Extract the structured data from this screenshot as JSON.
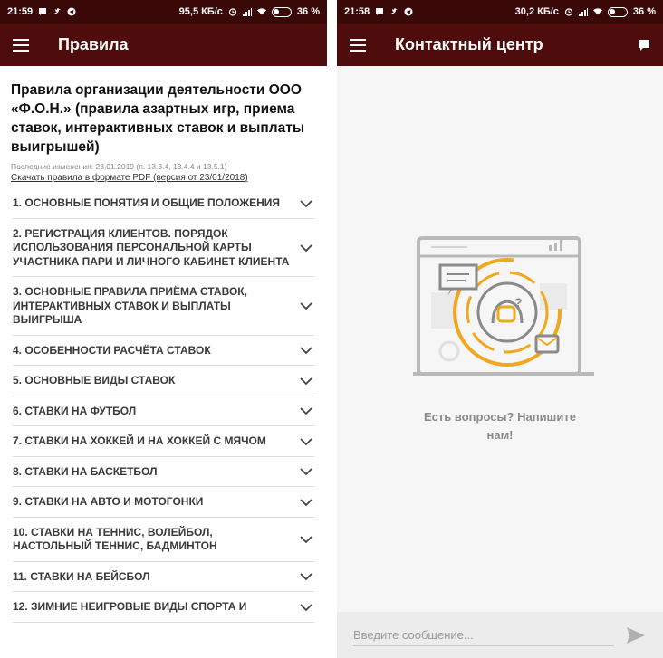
{
  "left": {
    "status": {
      "time": "21:59",
      "speed": "95,5 КБ/с",
      "battery": "36 %"
    },
    "appbar": {
      "title": "Правила"
    },
    "header": {
      "title": "Правила организации деятельности ООО «Ф.О.Н.» (правила азартных игр, приема ставок, интерактивных ставок и выплаты выигрышей)",
      "updated": "Последние изменения: 23.01.2019 (п. 13.3.4, 13.4.4 и 13.5.1)",
      "pdf_link": "Скачать правила в формате PDF (версия от 23/01/2018)"
    },
    "rules": [
      "1. ОСНОВНЫЕ ПОНЯТИЯ И ОБЩИЕ ПОЛОЖЕНИЯ",
      "2. РЕГИСТРАЦИЯ КЛИЕНТОВ. ПОРЯДОК ИСПОЛЬЗОВАНИЯ ПЕРСОНАЛЬНОЙ КАРТЫ УЧАСТНИКА ПАРИ И ЛИЧНОГО КАБИНЕТ КЛИЕНТА",
      "3. ОСНОВНЫЕ ПРАВИЛА ПРИЁМА СТАВОК, ИНТЕРАКТИВНЫХ СТАВОК И ВЫПЛАТЫ ВЫИГРЫША",
      "4. ОСОБЕННОСТИ РАСЧЁТА СТАВОК",
      "5. ОСНОВНЫЕ ВИДЫ СТАВОК",
      "6. СТАВКИ НА ФУТБОЛ",
      "7. СТАВКИ НА ХОККЕЙ И НА ХОККЕЙ С МЯЧОМ",
      "8. СТАВКИ НА БАСКЕТБОЛ",
      "9. СТАВКИ НА АВТО И МОТОГОНКИ",
      "10. СТАВКИ НА ТЕННИС, ВОЛЕЙБОЛ, НАСТОЛЬНЫЙ ТЕННИС, БАДМИНТОН",
      "11. СТАВКИ НА БЕЙСБОЛ",
      "12. ЗИМНИЕ НЕИГРОВЫЕ ВИДЫ СПОРТА И"
    ]
  },
  "right": {
    "status": {
      "time": "21:58",
      "speed": "30,2 КБ/с",
      "battery": "36 %"
    },
    "appbar": {
      "title": "Контактный центр"
    },
    "empty_state": {
      "text": "Есть вопросы? Напишите нам!"
    },
    "composer": {
      "placeholder": "Введите сообщение..."
    }
  },
  "colors": {
    "statusbar": "#3b0808",
    "appbar": "#4e0c0c",
    "accent_orange": "#f0a81e"
  },
  "icons": [
    "menu-icon",
    "chat-icon",
    "chevron-down-icon",
    "send-icon",
    "support-agent-icon"
  ]
}
